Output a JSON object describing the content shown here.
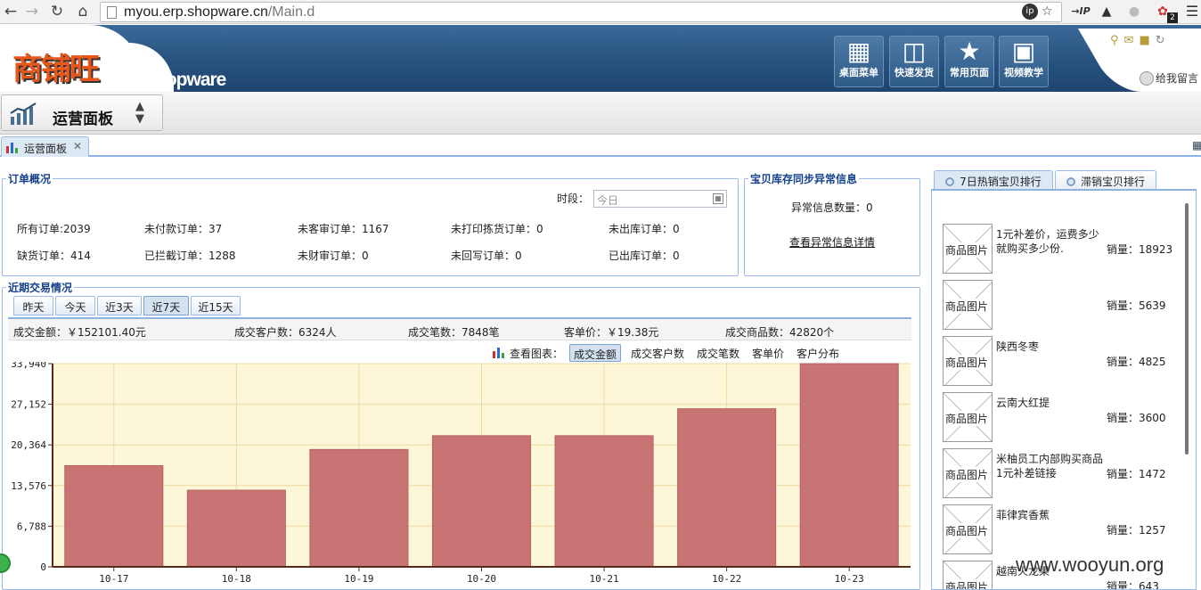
{
  "browser": {
    "url_host": "myou.erp.shopware.cn",
    "url_path": "/Main.d",
    "ext_badge": "2",
    "ext_ip": "→IP"
  },
  "header": {
    "logo_cn": "商铺旺",
    "logo_en": "Shopware",
    "buttons": [
      {
        "label": "桌面菜单",
        "icon": "desktop-icon"
      },
      {
        "label": "快速发货",
        "icon": "book-icon"
      },
      {
        "label": "常用页面",
        "icon": "star-icon"
      },
      {
        "label": "视频教学",
        "icon": "film-icon"
      }
    ],
    "feedback": "给我留言"
  },
  "toolbar": {
    "panel_title": "运营面板"
  },
  "tabs": [
    {
      "label": "运营面板"
    }
  ],
  "orders": {
    "legend": "订单概况",
    "time_label": "时段：",
    "date_placeholder": "今日",
    "stats": [
      [
        "所有订单:2039",
        "未付款订单：37",
        "未客审订单：1167",
        "未打印拣货订单：0",
        "未出库订单：0"
      ],
      [
        "缺货订单：414",
        "已拦截订单：1288",
        "未财审订单：0",
        "未回写订单：0",
        "已出库订单：0"
      ]
    ]
  },
  "inventory": {
    "legend": "宝贝库存同步异常信息",
    "count_label": "异常信息数量：0",
    "detail_link": "查看异常信息详情"
  },
  "ranking": {
    "tabs": [
      "7日热销宝贝排行",
      "滞销宝贝排行"
    ],
    "image_label": "商品图片",
    "items": [
      {
        "name": "1元补差价，运费多少就购买多少份.",
        "sales": "销量：18923"
      },
      {
        "name": "",
        "sales": "销量：5639"
      },
      {
        "name": "陕西冬枣",
        "sales": "销量：4825"
      },
      {
        "name": "云南大红提",
        "sales": "销量：3600"
      },
      {
        "name": "米柚员工内部购买商品1元补差链接",
        "sales": "销量：1472"
      },
      {
        "name": "菲律宾香蕉",
        "sales": "销量：1257"
      },
      {
        "name": "越南火龙果",
        "sales": "销量：643"
      }
    ]
  },
  "trade": {
    "legend": "近期交易情况",
    "periods": [
      "昨天",
      "今天",
      "近3天",
      "近7天",
      "近15天"
    ],
    "active_period": "近7天",
    "summary": {
      "amount": "成交金额：￥152101.40元",
      "customers": "成交客户数：6324人",
      "orders": "成交笔数：7848笔",
      "unit_price": "客单价：￥19.38元",
      "goods": "成交商品数：42820个"
    },
    "chart_label": "查看图表：",
    "chart_tools": [
      "成交金额",
      "成交客户数",
      "成交笔数",
      "客单价",
      "客户分布"
    ],
    "active_tool": "成交金额"
  },
  "watermark": "www.wooyun.org",
  "colors": {
    "bar": "#c87474",
    "bar_stroke": "#b86060",
    "plot_bg": "#fbf7d8",
    "grid": "#f0d8a0",
    "header_blue": "#2a5683",
    "logo_orange": "#e8561a"
  },
  "chart_data": {
    "type": "bar",
    "categories": [
      "10-17",
      "10-18",
      "10-19",
      "10-20",
      "10-21",
      "10-22",
      "10-23"
    ],
    "values": [
      16900,
      12800,
      19600,
      21900,
      21900,
      26400,
      33940
    ],
    "ylim": [
      0,
      33940
    ],
    "yticks": [
      "0",
      "6,788",
      "13,576",
      "20,364",
      "27,152",
      "33,940"
    ],
    "grid": true
  }
}
